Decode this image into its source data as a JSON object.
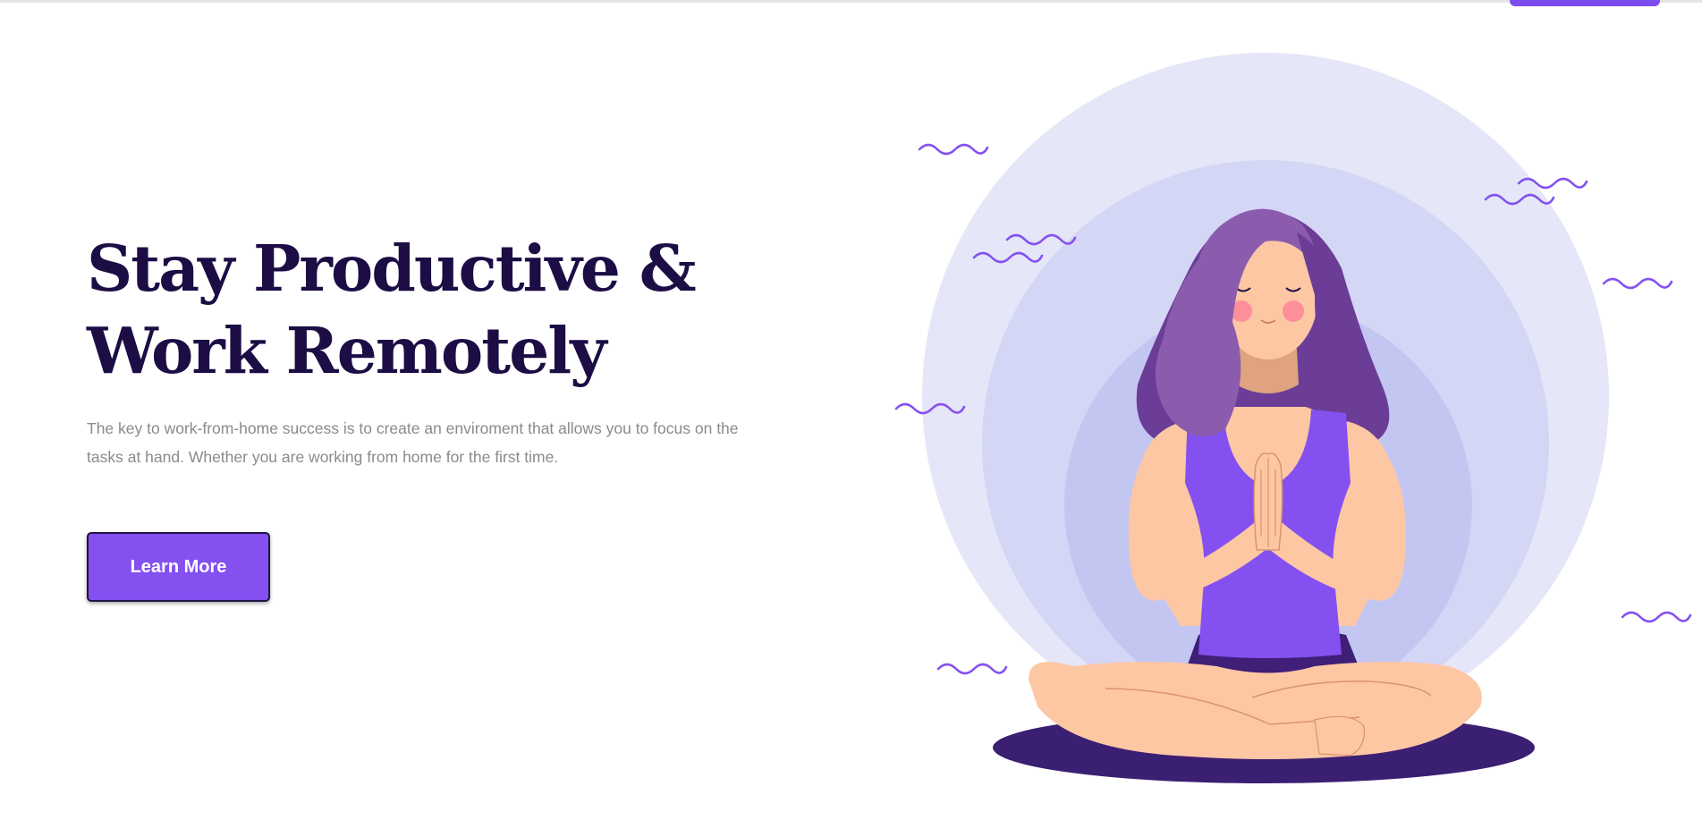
{
  "hero": {
    "title_line1": "Stay Productive &",
    "title_line2": "Work Remotely",
    "description": "The key to work-from-home success is to create an enviroment that allows you to focus on the tasks at hand. Whether you are working from home for the first time.",
    "cta_label": "Learn More"
  },
  "colors": {
    "accent": "#8451f0",
    "heading": "#1c0d45",
    "body_text": "#8a8a8f"
  },
  "illustration": {
    "subject": "meditating-woman",
    "decor": "wavy-lines"
  }
}
